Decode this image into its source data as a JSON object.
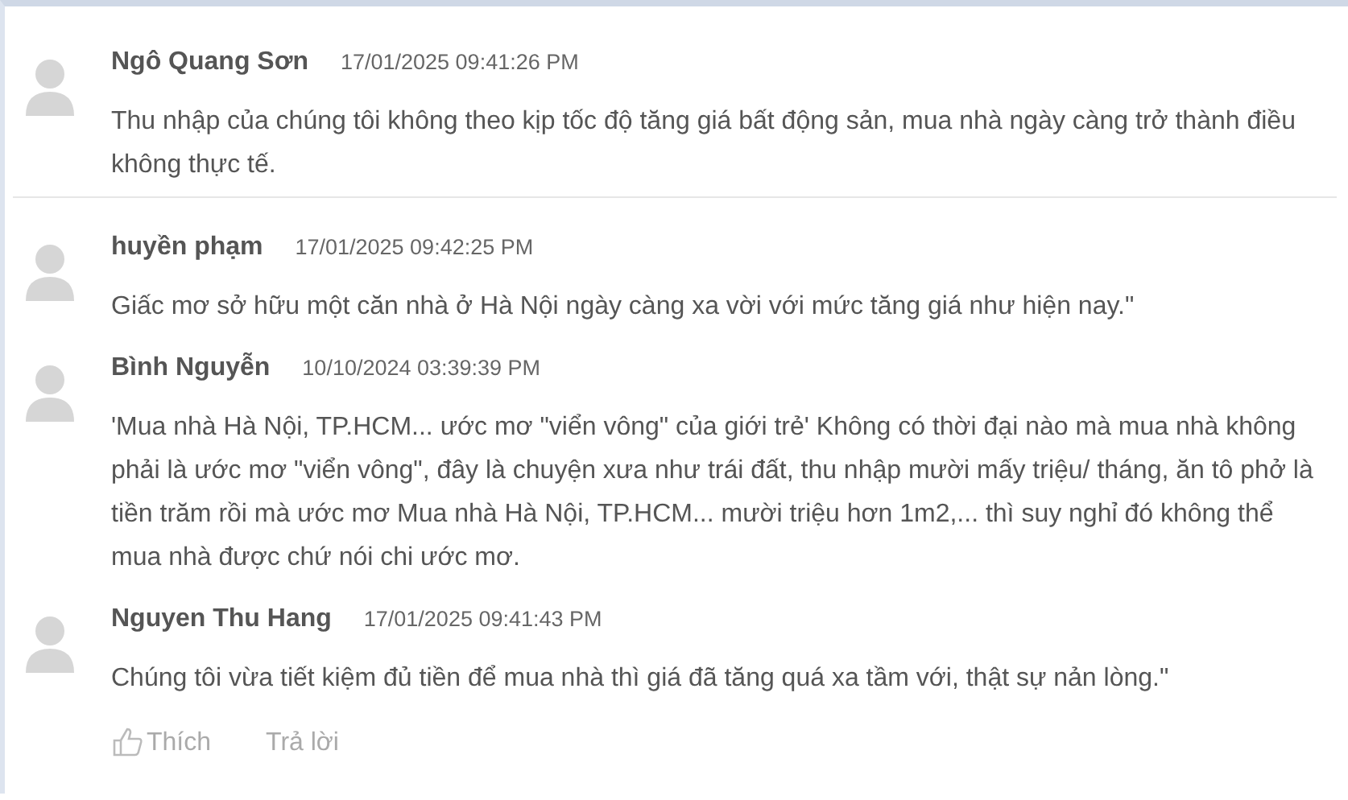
{
  "comments": [
    {
      "author": "Ngô Quang Sơn",
      "time": "17/01/2025 09:41:26 PM",
      "text": "Thu nhập của chúng tôi không theo kịp tốc độ tăng giá bất động sản, mua nhà ngày càng trở thành điều không thực tế."
    },
    {
      "author": "huyền phạm",
      "time": "17/01/2025 09:42:25 PM",
      "text": "Giấc mơ sở hữu một căn nhà ở Hà Nội ngày càng xa vời với mức tăng giá như hiện nay.\""
    },
    {
      "author": "Bình Nguyễn",
      "time": "10/10/2024 03:39:39 PM",
      "text": "'Mua nhà Hà Nội, TP.HCM... ước mơ \"viển vông\" của giới trẻ' Không có thời đại nào mà mua nhà không phải là ước mơ \"viển vông\", đây là chuyện xưa như trái đất, thu nhập mười mấy triệu/ tháng, ăn tô phở là tiền trăm rồi mà ước mơ Mua nhà Hà Nội, TP.HCM... mười triệu hơn 1m2,... thì suy nghỉ đó không thể mua nhà được chứ nói chi ước mơ."
    },
    {
      "author": "Nguyen Thu Hang",
      "time": "17/01/2025 09:41:43 PM",
      "text": "Chúng tôi vừa tiết kiệm đủ tiền để mua nhà thì giá đã tăng quá xa tầm với, thật sự nản lòng.\"",
      "actions": [
        {
          "kind": "like",
          "label": "Thích"
        },
        {
          "kind": "reply",
          "label": "Trả lời"
        }
      ]
    }
  ]
}
